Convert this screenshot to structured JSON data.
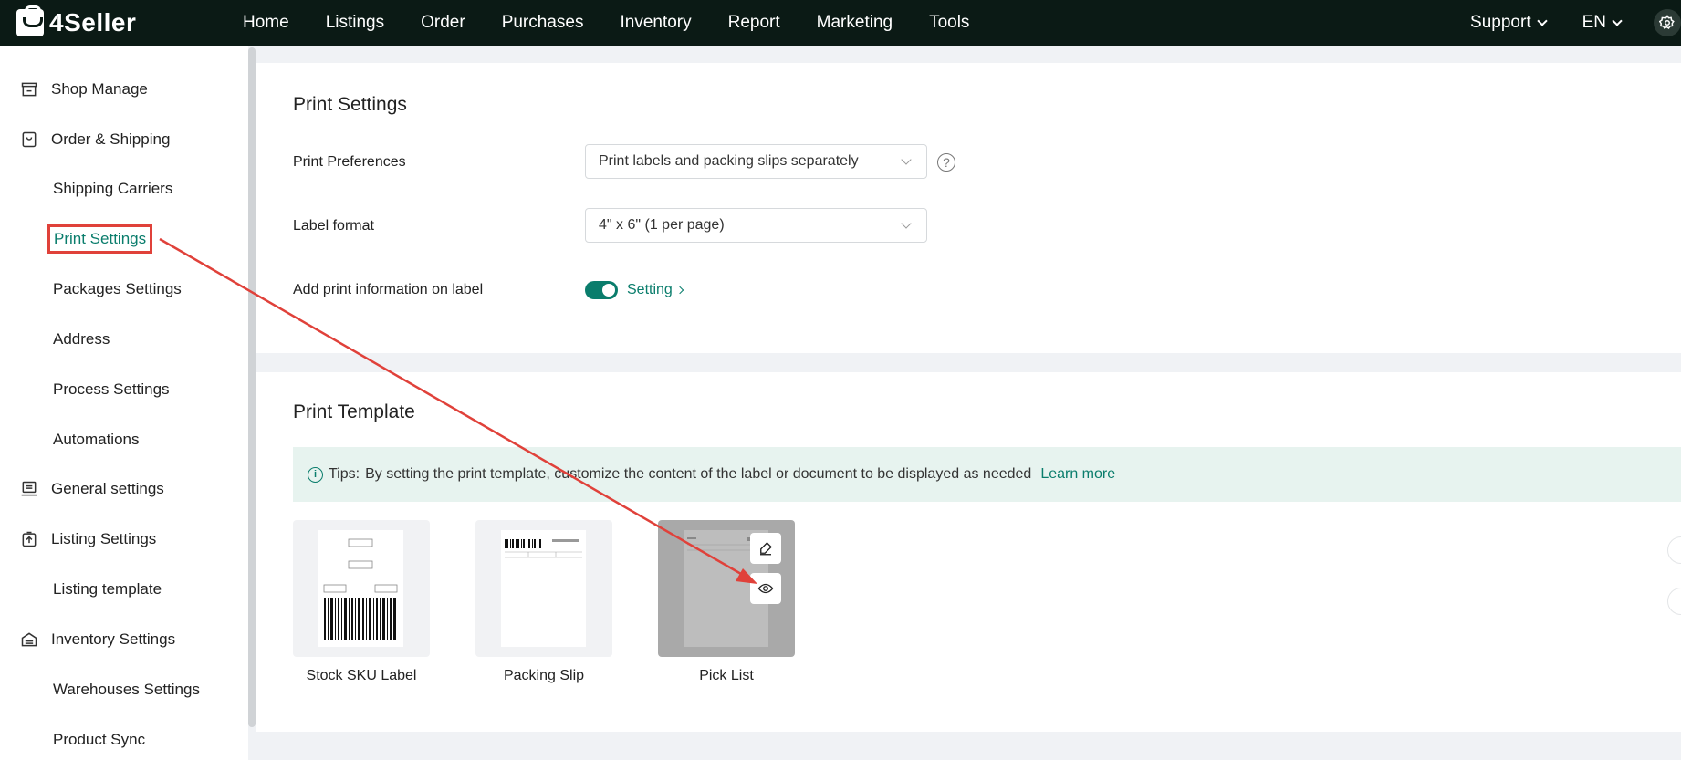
{
  "header": {
    "brand": "4Seller",
    "nav": [
      "Home",
      "Listings",
      "Order",
      "Purchases",
      "Inventory",
      "Report",
      "Marketing",
      "Tools"
    ],
    "support_label": "Support",
    "language_label": "EN"
  },
  "sidebar": {
    "items": [
      {
        "label": "Shop Manage",
        "icon": "shop-icon"
      },
      {
        "label": "Order & Shipping",
        "icon": "order-icon"
      },
      {
        "label": "Shipping Carriers"
      },
      {
        "label": "Print Settings",
        "active": true
      },
      {
        "label": "Packages Settings"
      },
      {
        "label": "Address"
      },
      {
        "label": "Process Settings"
      },
      {
        "label": "Automations"
      },
      {
        "label": "General settings",
        "icon": "general-settings-icon"
      },
      {
        "label": "Listing Settings",
        "icon": "listing-settings-icon"
      },
      {
        "label": "Listing template"
      },
      {
        "label": "Inventory Settings",
        "icon": "inventory-settings-icon"
      },
      {
        "label": "Warehouses Settings"
      },
      {
        "label": "Product Sync"
      }
    ]
  },
  "print_settings": {
    "title": "Print Settings",
    "preferences_label": "Print Preferences",
    "preferences_value": "Print labels and packing slips separately",
    "help_glyph": "?",
    "label_format_label": "Label format",
    "label_format_value": "4\" x 6\" (1 per page)",
    "print_info_label": "Add print information on label",
    "print_info_enabled": true,
    "setting_link": "Setting"
  },
  "print_template": {
    "title": "Print Template",
    "tips_prefix": "Tips:",
    "tips_text": "By setting the print template, customize the content of the label or document to be displayed as needed",
    "learn_more": "Learn more",
    "templates": [
      {
        "name": "Stock SKU Label"
      },
      {
        "name": "Packing Slip"
      },
      {
        "name": "Pick List",
        "hovered": true
      }
    ]
  },
  "colors": {
    "brand_green": "#0a7d6c",
    "header_bg": "#0b1a15",
    "annotation_red": "#e0413a"
  }
}
